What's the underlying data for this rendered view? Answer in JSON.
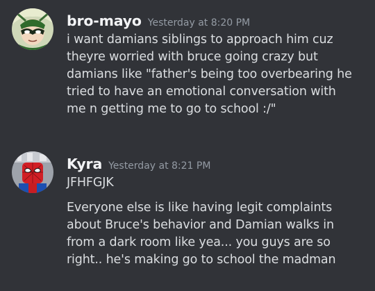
{
  "messages": [
    {
      "author": "bro-mayo",
      "timestamp": "Yesterday at 8:20 PM",
      "avatar": "green-masked-character-avatar",
      "lines": [
        "i want damians siblings to approach him cuz",
        "theyre worried with bruce going crazy but",
        "damians like \"father's being too overbearing he",
        "tried to have an emotional conversation with",
        "me n getting me to go to school :/\""
      ]
    },
    {
      "author": "Kyra",
      "timestamp": "Yesterday at 8:21 PM",
      "avatar": "lego-spiderman-avatar",
      "lines": [
        "JFHFGJK"
      ],
      "continuation": [
        "Everyone else is like having legit complaints",
        "about Bruce's behavior and Damian walks in",
        "from a dark room like yea... you guys are so",
        "right.. he's making go to school the madman"
      ]
    }
  ]
}
